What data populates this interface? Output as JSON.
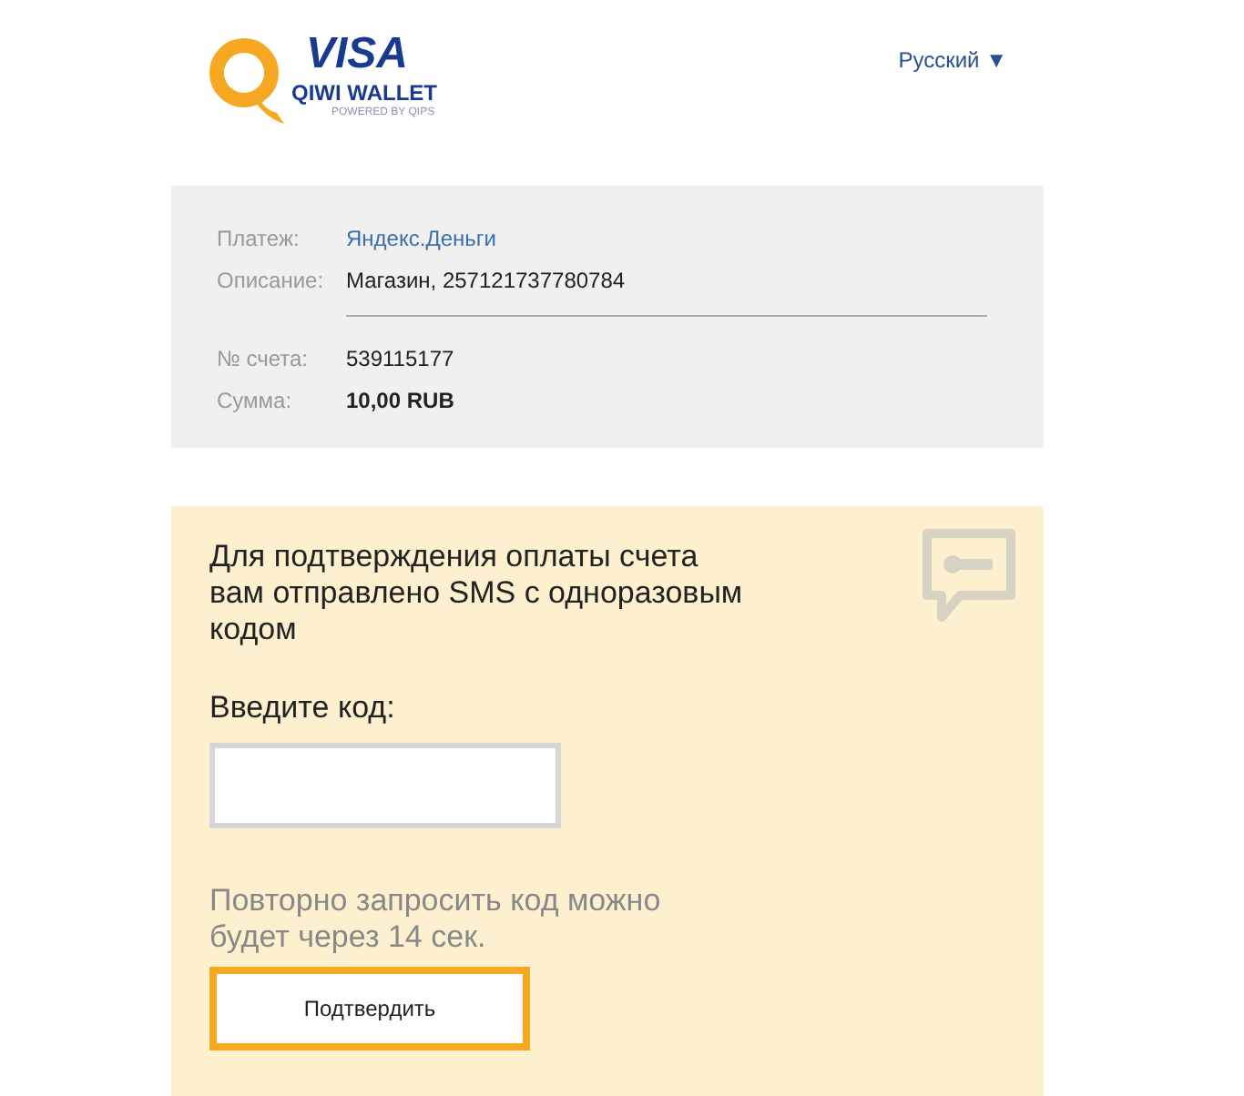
{
  "logo": {
    "brand": "VISA",
    "product": "QIWI WALLET",
    "tagline": "POWERED BY QIPS"
  },
  "language": {
    "label": "Русский",
    "caret": "▼"
  },
  "payment": {
    "rows": [
      {
        "kind": "link",
        "label": "Платеж:",
        "value": "Яндекс.Деньги"
      },
      {
        "kind": "text",
        "label": "Описание:",
        "value": "Магазин, 257121737780784"
      },
      {
        "kind": "divider"
      },
      {
        "kind": "text",
        "label": "№ счета:",
        "value": "539115177"
      },
      {
        "kind": "bold",
        "label": "Сумма:",
        "value": "10,00 RUB"
      }
    ]
  },
  "confirmation": {
    "message": "Для подтверждения оплаты счета вам отправлено SMS с одноразовым кодом",
    "code_label": "Введите код:",
    "resend_note": "Повторно запросить код можно будет через 14 сек.",
    "button": "Подтвердить"
  }
}
